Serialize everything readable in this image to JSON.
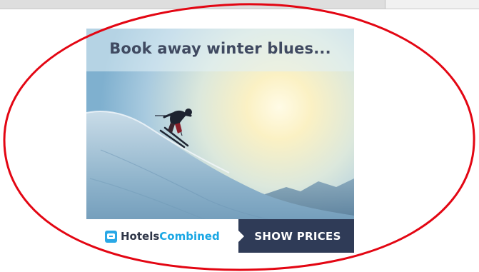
{
  "ad": {
    "headline": "Book away winter blues...",
    "brand": {
      "name_part1": "Hotels",
      "name_part2": "Combined",
      "icon": "hotelscombined-logo-icon"
    },
    "cta_label": "SHOW PRICES"
  },
  "colors": {
    "headline_text": "#404a61",
    "cta_background": "#2f3b57",
    "brand_accent": "#1aa7e4",
    "annotation_circle": "#e30613"
  }
}
